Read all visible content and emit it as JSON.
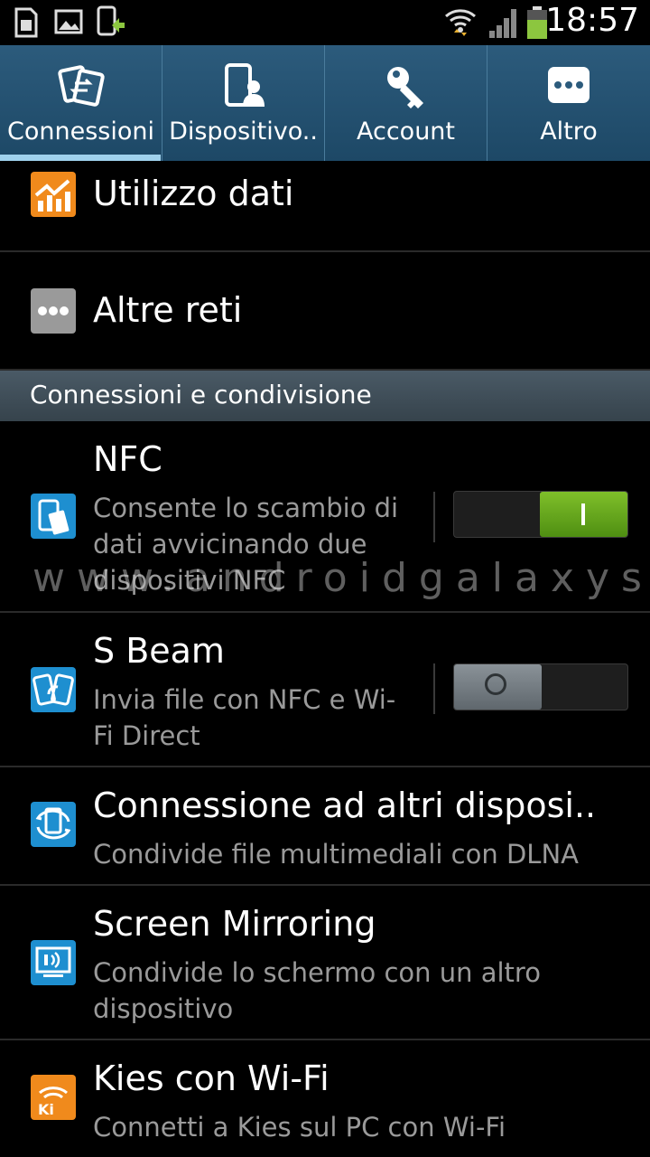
{
  "status_bar": {
    "time": "18:57",
    "icons": [
      "sd-card-icon",
      "image-icon",
      "phone-update-icon",
      "wifi-icon",
      "signal-icon",
      "battery-icon"
    ]
  },
  "tabs": [
    {
      "label": "Connessioni",
      "icon": "connections-icon",
      "active": true
    },
    {
      "label": "Dispositivo..",
      "icon": "device-icon",
      "active": false
    },
    {
      "label": "Account",
      "icon": "key-icon",
      "active": false
    },
    {
      "label": "Altro",
      "icon": "more-icon",
      "active": false
    }
  ],
  "rows": {
    "data_usage": {
      "title": "Utilizzo dati",
      "icon": "data-usage-icon"
    },
    "more_networks": {
      "title": "Altre reti",
      "icon": "more-networks-icon"
    },
    "nfc": {
      "title": "NFC",
      "subtitle": "Consente lo scambio di dati avvicinando due dispositivi NFC",
      "subtitle_lines": [
        "Consente lo scambio di",
        "dati avvicinando due",
        "dispositivi NFC"
      ],
      "enabled": true,
      "icon": "nfc-icon"
    },
    "s_beam": {
      "title": "S Beam",
      "subtitle_lines": [
        "Invia file con NFC e Wi-",
        "Fi Direct"
      ],
      "enabled": false,
      "icon": "s-beam-icon"
    },
    "nearby": {
      "title": "Connessione ad altri disposi..",
      "subtitle_lines": [
        "Condivide file multimediali con DLNA"
      ],
      "icon": "nearby-devices-icon"
    },
    "mirroring": {
      "title": "Screen Mirroring",
      "subtitle_lines": [
        "Condivide lo schermo con un altro",
        "dispositivo"
      ],
      "icon": "screen-mirroring-icon"
    },
    "kies": {
      "title": "Kies con Wi-Fi",
      "subtitle_lines": [
        "Connetti a Kies sul PC con Wi-Fi"
      ],
      "icon": "kies-icon"
    }
  },
  "section_header": "Connessioni e condivisione",
  "watermark": "www.androidgalaxys.net",
  "colors": {
    "accent_tab": "#2c5b7c",
    "switch_on": "#6aa81f",
    "tab_underline": "#9fd1ec"
  }
}
